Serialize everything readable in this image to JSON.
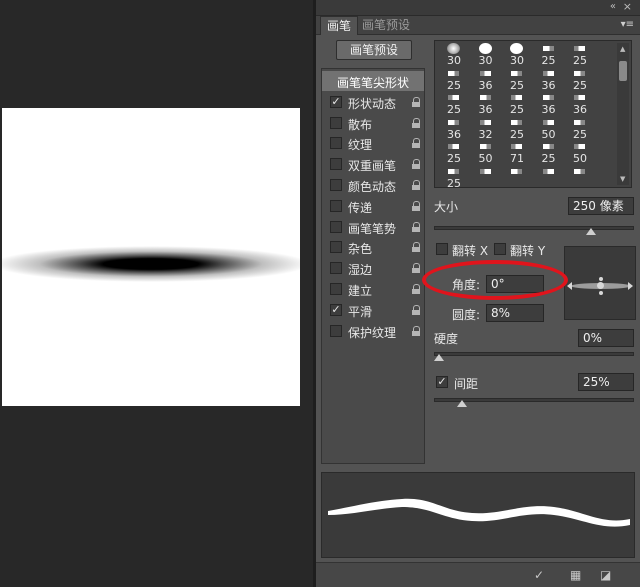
{
  "panel": {
    "tabs": [
      "画笔",
      "画笔预设"
    ],
    "preset_button": "画笔预设",
    "options": [
      {
        "label": "画笔笔尖形状",
        "checked": false,
        "header": true,
        "locked": false
      },
      {
        "label": "形状动态",
        "checked": true,
        "header": false,
        "locked": true
      },
      {
        "label": "散布",
        "checked": false,
        "header": false,
        "locked": true
      },
      {
        "label": "纹理",
        "checked": false,
        "header": false,
        "locked": true
      },
      {
        "label": "双重画笔",
        "checked": false,
        "header": false,
        "locked": true
      },
      {
        "label": "颜色动态",
        "checked": false,
        "header": false,
        "locked": true
      },
      {
        "label": "传递",
        "checked": false,
        "header": false,
        "locked": true
      },
      {
        "label": "画笔笔势",
        "checked": false,
        "header": false,
        "locked": true
      },
      {
        "label": "杂色",
        "checked": false,
        "header": false,
        "locked": true
      },
      {
        "label": "湿边",
        "checked": false,
        "header": false,
        "locked": true
      },
      {
        "label": "建立",
        "checked": false,
        "header": false,
        "locked": true
      },
      {
        "label": "平滑",
        "checked": true,
        "header": false,
        "locked": true
      },
      {
        "label": "保护纹理",
        "checked": false,
        "header": false,
        "locked": true
      }
    ],
    "brush_tips": [
      [
        "30",
        "30",
        "30",
        "25",
        "25"
      ],
      [
        "25",
        "36",
        "25",
        "36",
        "25"
      ],
      [
        "25",
        "36",
        "25",
        "36",
        "36"
      ],
      [
        "36",
        "32",
        "25",
        "50",
        "25"
      ],
      [
        "25",
        "50",
        "71",
        "25",
        "50"
      ],
      [
        "25",
        "",
        "",
        "",
        ""
      ]
    ],
    "size_label": "大小",
    "size_value": "250 像素",
    "size_fraction": 0.8,
    "flip_x_label": "翻转 X",
    "flip_y_label": "翻转 Y",
    "angle_label": "角度:",
    "angle_value": "0°",
    "roundness_label": "圆度:",
    "roundness_value": "8%",
    "hardness_label": "硬度",
    "hardness_value": "0%",
    "hardness_fraction": 0.0,
    "spacing_label": "间距",
    "spacing_checked": true,
    "spacing_value": "25%",
    "spacing_fraction": 0.12,
    "colors": {
      "highlight": "#e0141c",
      "panel": "#535353",
      "canvas": "#282828"
    },
    "bottom_icons": [
      "brush-tool-icon",
      "grid-icon",
      "new-preset-icon"
    ]
  }
}
